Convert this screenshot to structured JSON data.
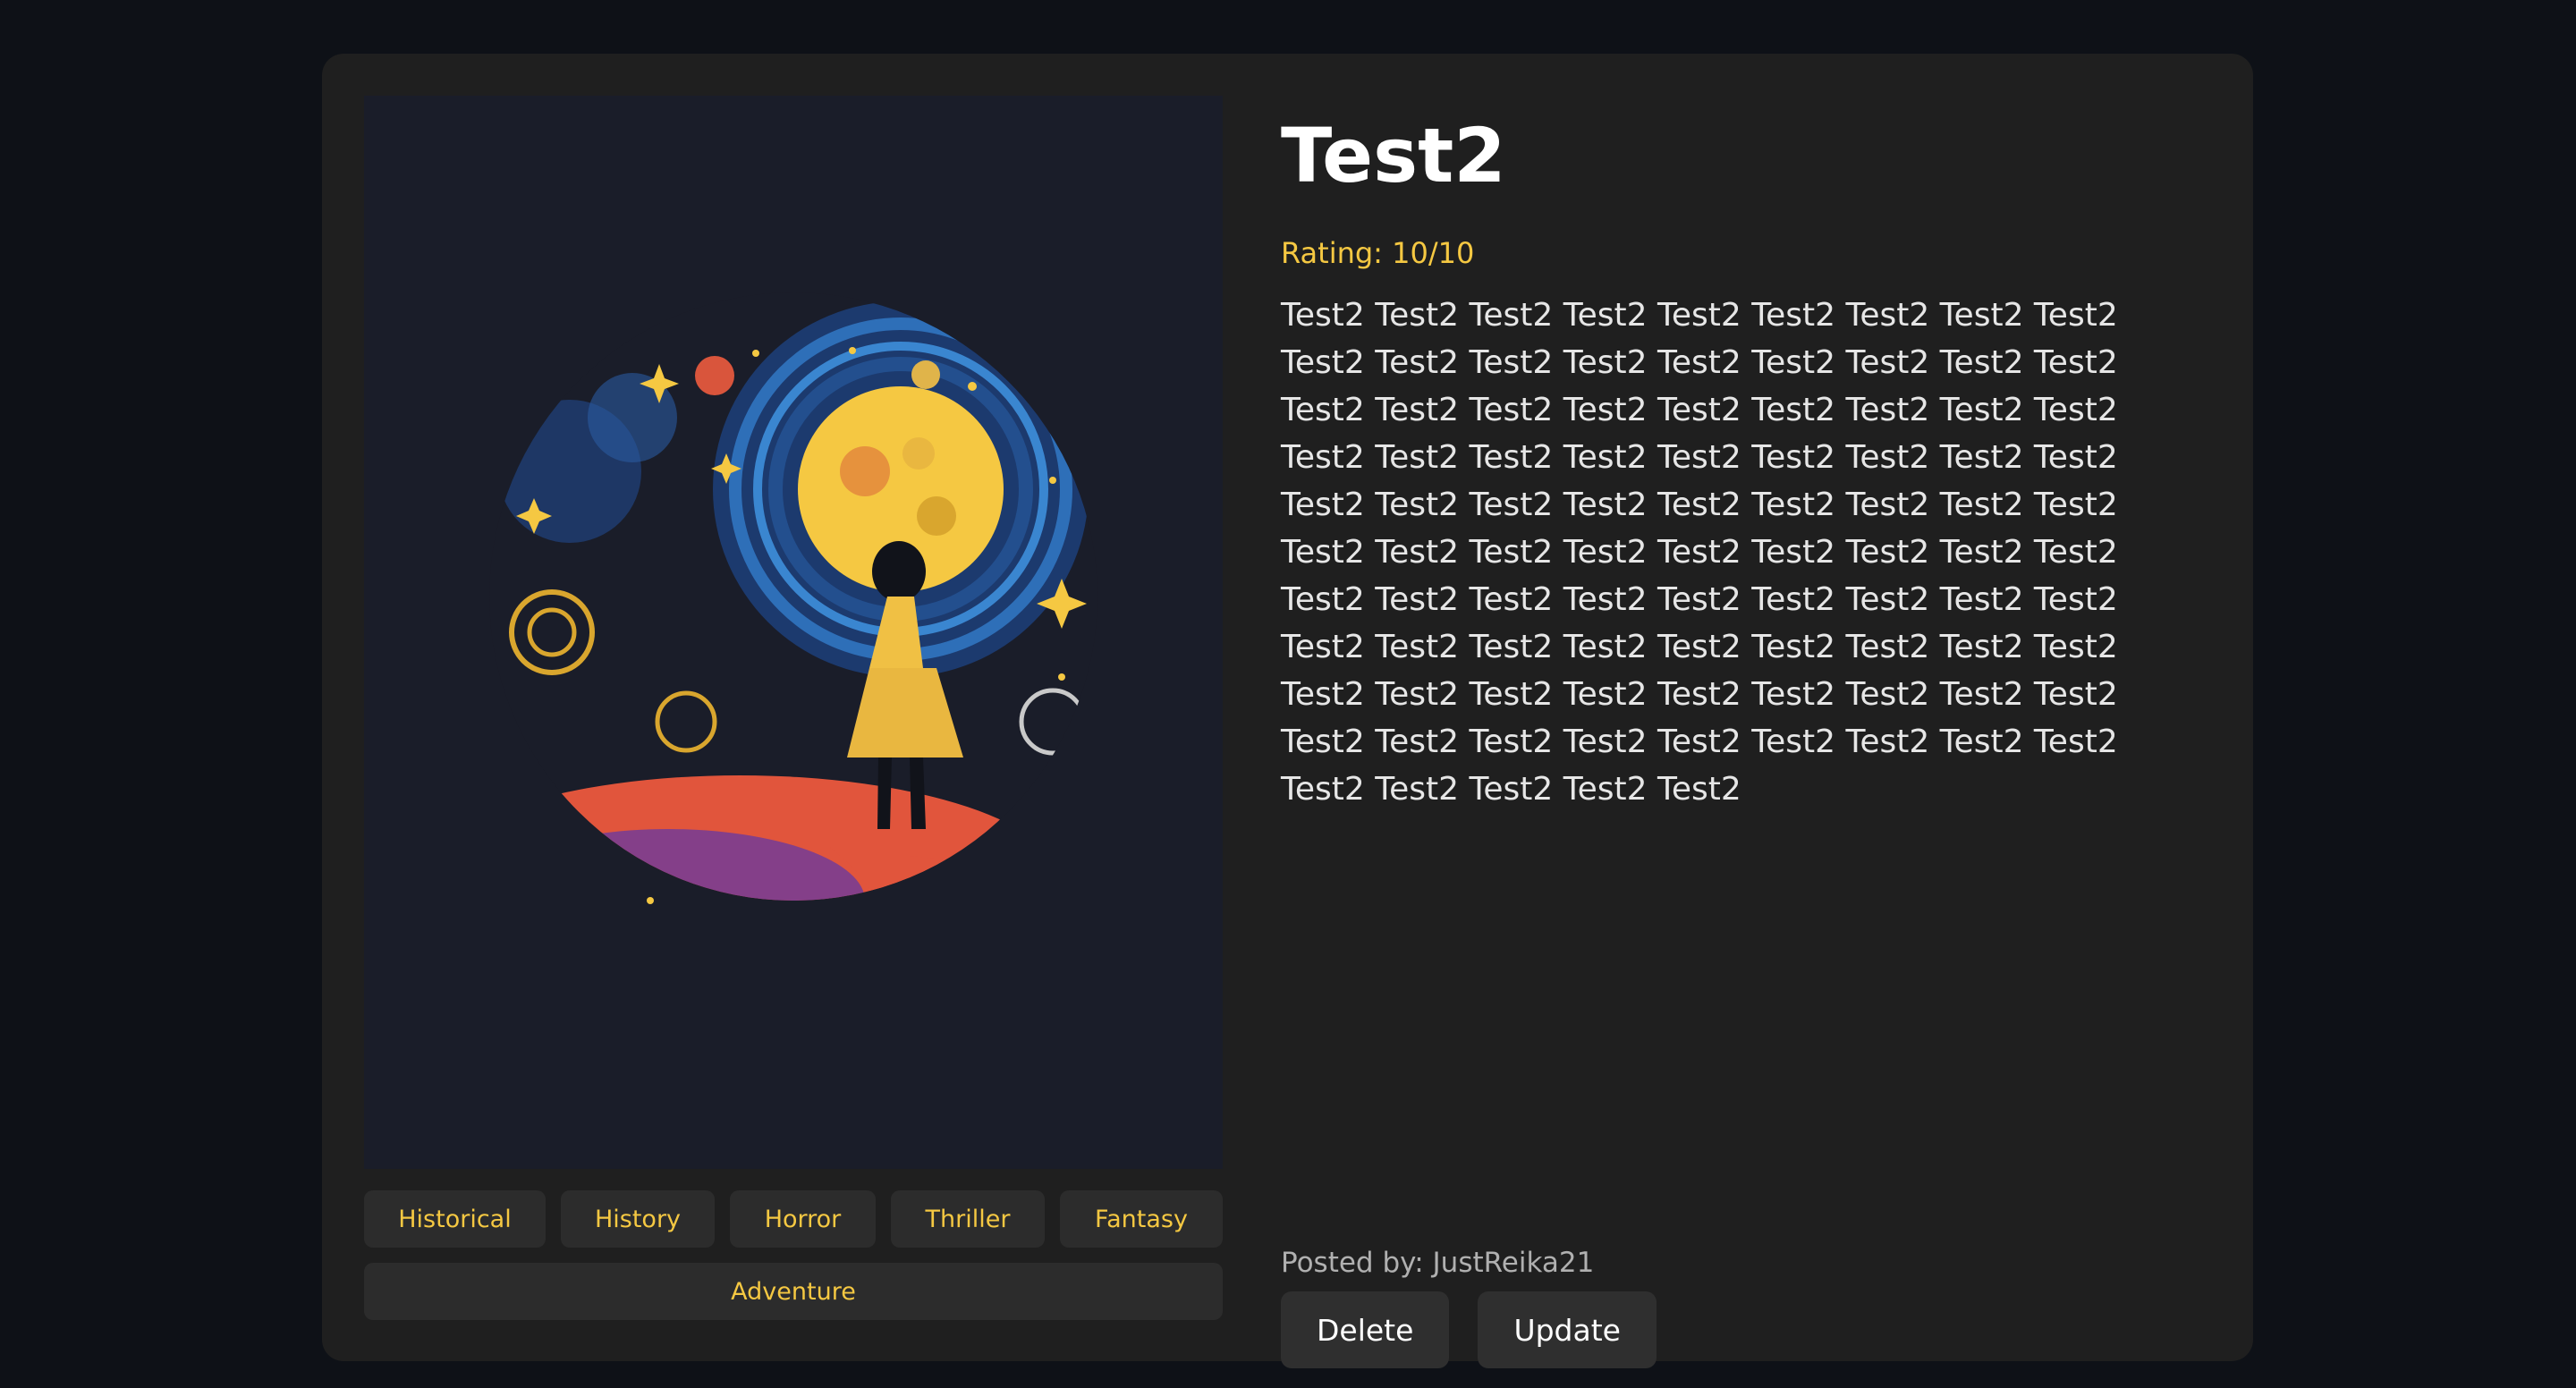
{
  "book": {
    "title": "Test2",
    "rating": "Rating: 10/10",
    "description": "Test2 Test2 Test2 Test2 Test2 Test2 Test2 Test2 Test2 Test2 Test2 Test2 Test2 Test2 Test2 Test2 Test2 Test2 Test2 Test2 Test2 Test2 Test2 Test2 Test2 Test2 Test2 Test2 Test2 Test2 Test2 Test2 Test2 Test2 Test2 Test2 Test2 Test2 Test2 Test2 Test2 Test2 Test2 Test2 Test2 Test2 Test2 Test2 Test2 Test2 Test2 Test2 Test2 Test2 Test2 Test2 Test2 Test2 Test2 Test2 Test2 Test2 Test2 Test2 Test2 Test2 Test2 Test2 Test2 Test2 Test2 Test2 Test2 Test2 Test2 Test2 Test2 Test2 Test2 Test2 Test2 Test2 Test2 Test2 Test2 Test2 Test2 Test2 Test2 Test2 Test2 Test2 Test2 Test2 Test2",
    "posted_by": "Posted by: JustReika21"
  },
  "tags": [
    "Historical",
    "History",
    "Horror",
    "Thriller",
    "Fantasy",
    "Adventure"
  ],
  "actions": {
    "delete_label": "Delete",
    "update_label": "Update"
  },
  "colors": {
    "page_bg": "#0e1117",
    "card_bg": "#1f1f1f",
    "accent": "#f5c842",
    "button_bg": "#2f2f2f"
  }
}
